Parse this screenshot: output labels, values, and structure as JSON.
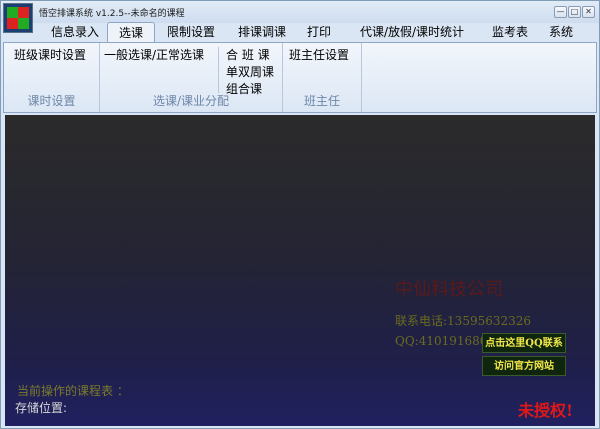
{
  "window": {
    "title": "悟空排课系统 v1.2.5--未命名的课程",
    "min_symbol": "—",
    "max_symbol": "□",
    "close_symbol": "✕"
  },
  "tabs": [
    {
      "label": "信息录入",
      "active": false
    },
    {
      "label": "选课",
      "active": true
    },
    {
      "label": "限制设置",
      "active": false
    },
    {
      "label": "排课调课",
      "active": false
    },
    {
      "label": "打印",
      "active": false
    },
    {
      "label": "代课/放假/课时统计",
      "active": false
    },
    {
      "label": "监考表",
      "active": false
    },
    {
      "label": "系统",
      "active": false
    }
  ],
  "ribbon": {
    "groups": [
      {
        "label": "课时设置",
        "buttons": [
          "班级课时设置"
        ]
      },
      {
        "label": "选课/课业分配",
        "buttons": [
          "一般选课/正常选课",
          "合 班 课",
          "单双周课",
          "组合课"
        ]
      },
      {
        "label": "班主任",
        "buttons": [
          "班主任设置"
        ]
      }
    ]
  },
  "main": {
    "company": "中仙科技公司",
    "contact": "联系电话:13595632326",
    "qq": "QQ:410191680",
    "qq_button": "点击这里QQ联系",
    "website_button": "访问官方网站",
    "current_table_label": "当前操作的课程表 ：",
    "storage_label": "存储位置:",
    "unauthorized": "未授权!"
  },
  "colors": {
    "company": "#5a1a1a",
    "contact": "#6b6b1f",
    "button_bg": "#10250e",
    "button_text": "#f1e84a",
    "unauthorized": "#e01818"
  },
  "icons": {
    "app": "app-logo-icon"
  }
}
